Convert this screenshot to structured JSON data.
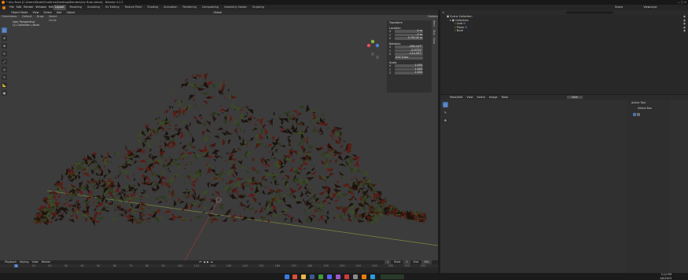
{
  "titlebar": {
    "title": "* Airy Bush [C:\\Users\\Model\\OneDrive\\Desktop\\Blender\\Airy Bush.blend] - Blender 4.2.2",
    "controls": "—  ▢  ✕"
  },
  "menubar": {
    "menus": [
      "File",
      "Edit",
      "Render",
      "Window",
      "Help"
    ],
    "workspaces": [
      "Layout",
      "Modeling",
      "Sculpting",
      "UV Editing",
      "Texture Paint",
      "Shading",
      "Animation",
      "Rendering",
      "Compositing",
      "Geometry Nodes",
      "Scripting"
    ],
    "scene_label": "Scene",
    "view_layer_label": "ViewLayer"
  },
  "viewport": {
    "header": [
      "Object Mode",
      "View",
      "Select",
      "Add",
      "Object"
    ],
    "transform_orientation": "Global",
    "header2": [
      "Orientation:",
      "Default",
      "Drag:",
      "Select Circle"
    ],
    "options": "Options",
    "info_line1": "User Perspective",
    "info_line2": "(1) Collection | Bush",
    "npanel": {
      "title": "Transform",
      "location_label": "Location:",
      "location": [
        {
          "axis": "X",
          "value": "0 m"
        },
        {
          "axis": "Y",
          "value": "0 m"
        },
        {
          "axis": "Z",
          "value": "0.70216 m"
        }
      ],
      "rotation_label": "Rotation:",
      "rotation": [
        {
          "axis": "X",
          "value": "-180.147°"
        },
        {
          "axis": "Y",
          "value": "-0.0722°"
        },
        {
          "axis": "Z",
          "value": "-114.397°"
        }
      ],
      "rotation_mode": "XYZ Euler",
      "scale_label": "Scale:",
      "scale": [
        {
          "axis": "X",
          "value": "1.000"
        },
        {
          "axis": "Y",
          "value": "1.000"
        },
        {
          "axis": "Z",
          "value": "1.000"
        }
      ],
      "tabs": [
        "Item",
        "Tool",
        "View"
      ]
    }
  },
  "timeline": {
    "header": [
      "Playback",
      "Keying",
      "View",
      "Marker"
    ],
    "current_frame": "1",
    "start_label": "Start",
    "start": "1",
    "end_label": "End",
    "end": "250",
    "ticks": [
      "0",
      "10",
      "20",
      "30",
      "40",
      "50",
      "60",
      "70",
      "80",
      "90",
      "100",
      "110",
      "120",
      "130",
      "140",
      "150",
      "160",
      "170",
      "180",
      "190",
      "200",
      "210",
      "220",
      "230",
      "240",
      "250"
    ]
  },
  "outliner": {
    "title": "Scene Collection",
    "collection": "Collection",
    "items": [
      "Leaf",
      "Plane",
      "Bush"
    ]
  },
  "image_editor": {
    "header": [
      "View",
      "Select",
      "Image",
      "Mask"
    ],
    "mode": "Mask/Edit",
    "new_button": "New"
  },
  "sidebar": {
    "active_tool": "Active Tool",
    "tool": "Select Box"
  },
  "taskbar": {
    "time": "5:12 PM",
    "date": "1/6/2025"
  },
  "colors": {
    "accent": "#4772b3",
    "viewport_bg": "#3c3c3c",
    "panel_bg": "#303030",
    "leaf_dark": "#241610",
    "leaf_red": "#5e1a14",
    "leaf_green": "#3b4a22"
  }
}
